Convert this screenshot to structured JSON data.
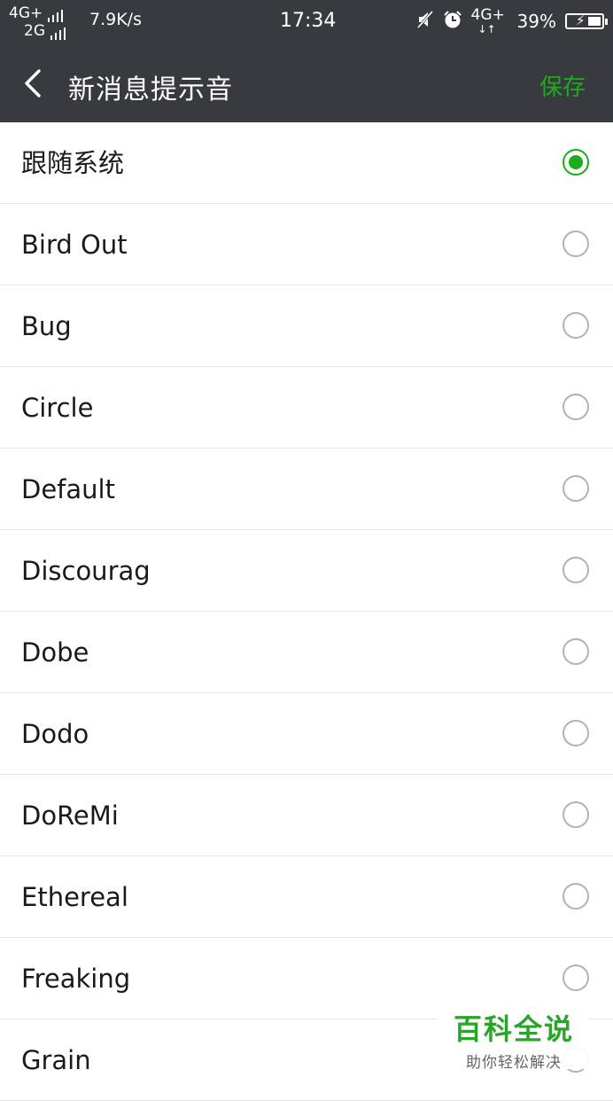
{
  "status_bar": {
    "network1": "4G+",
    "network2": "2G",
    "speed": "7.9K/s",
    "time": "17:34",
    "network_right": "4G+",
    "battery": "39%",
    "icons": [
      "mute-icon",
      "alarm-icon",
      "signal-icon",
      "battery-charging-icon"
    ]
  },
  "header": {
    "title": "新消息提示音",
    "save_label": "保存",
    "accent_color": "#1aad19",
    "background_color": "#393a3f"
  },
  "options": [
    {
      "label": "跟随系统",
      "checked": true
    },
    {
      "label": "Bird Out",
      "checked": false
    },
    {
      "label": "Bug",
      "checked": false
    },
    {
      "label": "Circle",
      "checked": false
    },
    {
      "label": "Default",
      "checked": false
    },
    {
      "label": "Discourag",
      "checked": false
    },
    {
      "label": "Dobe",
      "checked": false
    },
    {
      "label": "Dodo",
      "checked": false
    },
    {
      "label": "DoReMi",
      "checked": false
    },
    {
      "label": "Ethereal",
      "checked": false
    },
    {
      "label": "Freaking",
      "checked": false
    },
    {
      "label": "Grain",
      "checked": false
    }
  ],
  "watermark": {
    "main": "百科全说",
    "sub": "助你轻松解决"
  }
}
